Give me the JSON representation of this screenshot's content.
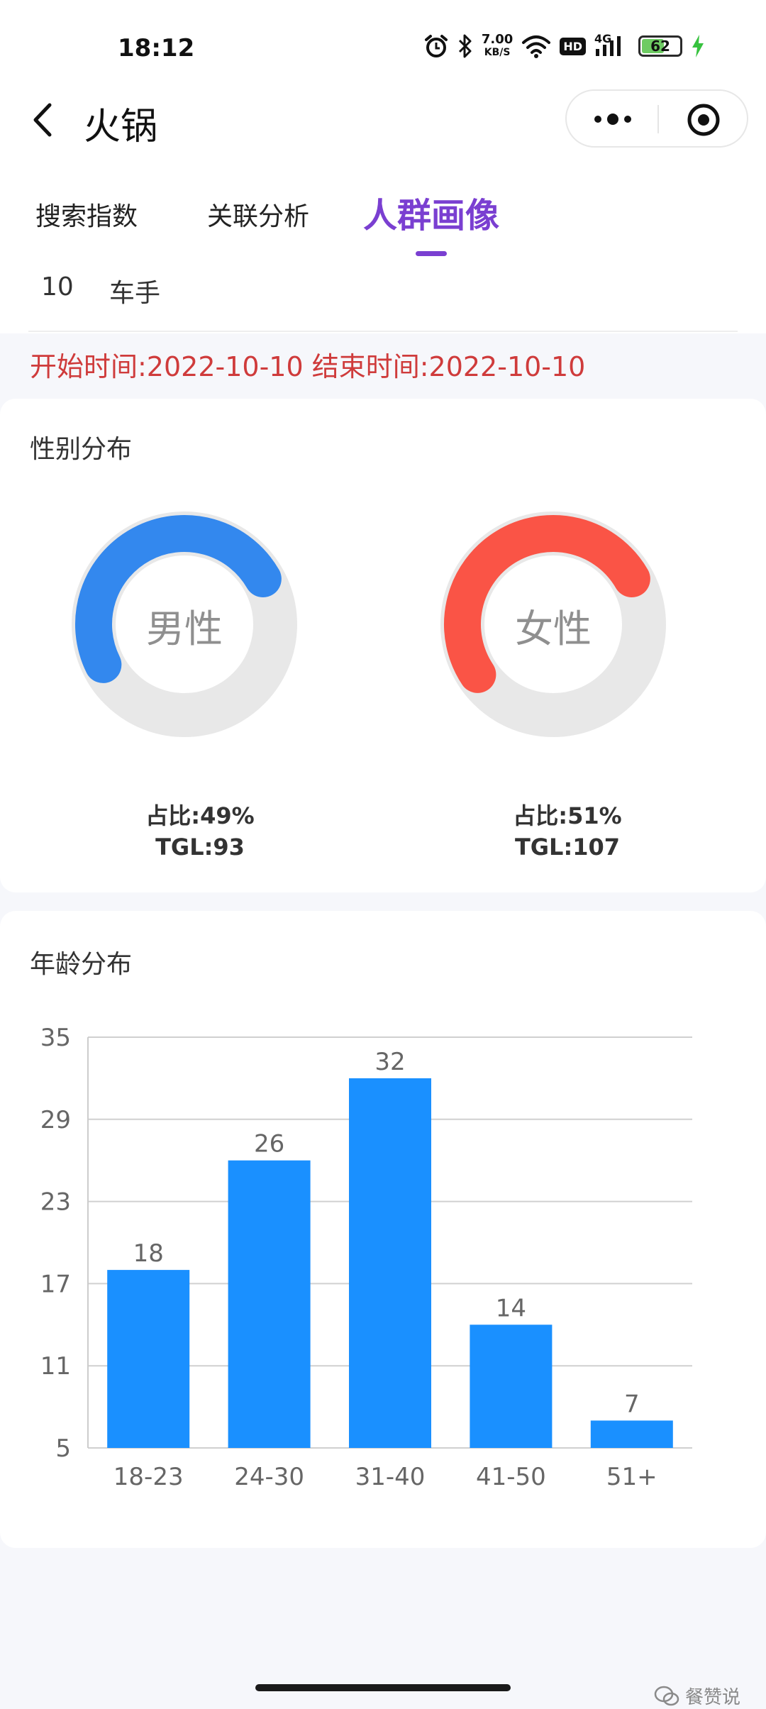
{
  "status_bar": {
    "time": "18:12",
    "network_speed_value": "7.00",
    "network_speed_unit": "KB/S",
    "hd_badge": "HD",
    "signal_type": "4G",
    "battery": "62",
    "icons": [
      "alarm-icon",
      "bluetooth-icon",
      "wifi-icon",
      "signal-icon",
      "battery-icon",
      "charging-icon"
    ]
  },
  "nav": {
    "title": "火锅",
    "back_icon": "chevron-left-icon",
    "more_icon": "more-dots-icon",
    "close_icon": "record-target-icon"
  },
  "tabs": [
    {
      "label": "搜索指数",
      "active": false
    },
    {
      "label": "关联分析",
      "active": false
    },
    {
      "label": "人群画像",
      "active": true
    }
  ],
  "subrow": {
    "rank": "10",
    "role": "车手"
  },
  "date_range": "开始时间:2022-10-10 结束时间:2022-10-10",
  "gender": {
    "title": "性别分布",
    "male": {
      "label": "男性",
      "share_text": "占比:49%",
      "tgl_text": "TGL:93",
      "share": 0.49,
      "color": "#3388ee"
    },
    "female": {
      "label": "女性",
      "share_text": "占比:51%",
      "tgl_text": "TGL:107",
      "share": 0.51,
      "color": "#fa5446"
    },
    "track_color": "#e8e8e8"
  },
  "age": {
    "title": "年龄分布"
  },
  "chart_data": {
    "type": "bar",
    "categories": [
      "18-23",
      "24-30",
      "31-40",
      "41-50",
      "51+"
    ],
    "values": [
      18,
      26,
      32,
      14,
      7
    ],
    "yticks": [
      5,
      11,
      17,
      23,
      29,
      35
    ],
    "ylim": [
      5,
      35
    ],
    "grid": true,
    "bar_color": "#1a90ff",
    "title": "",
    "xlabel": "",
    "ylabel": ""
  },
  "watermark": "餐赞说"
}
